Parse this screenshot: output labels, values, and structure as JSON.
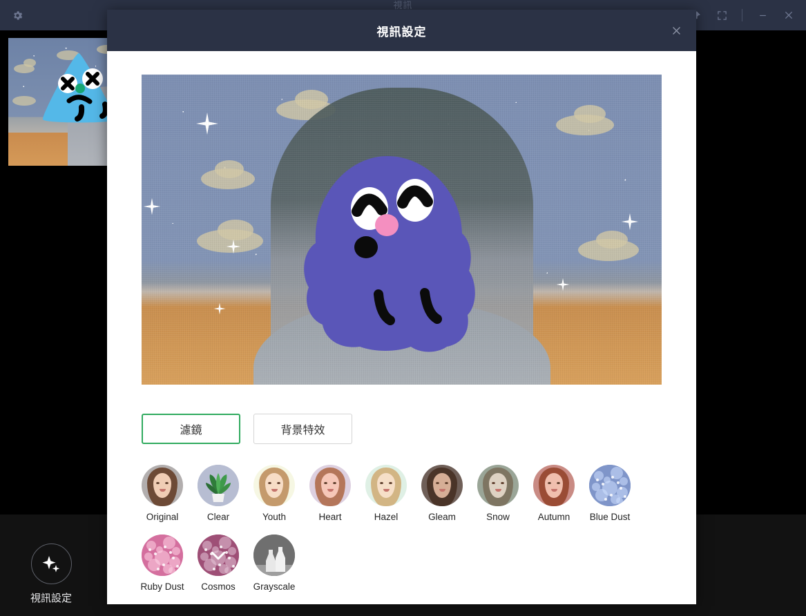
{
  "window": {
    "title_partial": "視訊",
    "gear_icon": "gear-icon",
    "controls": [
      {
        "name": "pin-icon",
        "label": "Pin"
      },
      {
        "name": "fullscreen-icon",
        "label": "Fullscreen"
      },
      {
        "name": "minimize-icon",
        "label": "Minimize"
      },
      {
        "name": "close-icon",
        "label": "Close"
      }
    ]
  },
  "toolbar": {
    "video_settings_label": "視訊設定",
    "video_settings_icon": "sparkle-icon"
  },
  "dialog": {
    "title": "視訊設定",
    "close_icon": "close-icon",
    "preview": {
      "name": "video-preview",
      "description": "Live camera preview with starry sky virtual background and purple doodle overlay"
    },
    "tabs": [
      {
        "label": "濾鏡",
        "active": true
      },
      {
        "label": "背景特效",
        "active": false
      }
    ],
    "filters": [
      {
        "label": "Original",
        "selected": false,
        "kind": "portrait",
        "bg": "#b2aeae",
        "hair": "#6d4a36",
        "skin": "#f0cdb5"
      },
      {
        "label": "Clear",
        "selected": false,
        "kind": "plant",
        "bg": "#b7bdd2"
      },
      {
        "label": "Youth",
        "selected": false,
        "kind": "portrait",
        "bg": "#f6f7e3",
        "hair": "#c49a6c",
        "skin": "#f7ddc6"
      },
      {
        "label": "Heart",
        "selected": false,
        "kind": "portrait",
        "bg": "#ddd0e0",
        "hair": "#b4765a",
        "skin": "#f6c7b8"
      },
      {
        "label": "Hazel",
        "selected": false,
        "kind": "portrait",
        "bg": "#dff0e5",
        "hair": "#d2b584",
        "skin": "#f6dfc8"
      },
      {
        "label": "Gleam",
        "selected": false,
        "kind": "portrait",
        "bg": "#6f5f58",
        "hair": "#4a3428",
        "skin": "#d6ae96"
      },
      {
        "label": "Snow",
        "selected": false,
        "kind": "portrait",
        "bg": "#9aa597",
        "hair": "#7e7562",
        "skin": "#ded2c3"
      },
      {
        "label": "Autumn",
        "selected": false,
        "kind": "portrait",
        "bg": "#c98b84",
        "hair": "#9a4c35",
        "skin": "#f0bfae"
      },
      {
        "label": "Blue Dust",
        "selected": false,
        "kind": "dust",
        "bg": "#7f95c9",
        "dust": "#cfe0ff"
      },
      {
        "label": "Ruby Dust",
        "selected": false,
        "kind": "dust",
        "bg": "#d46f9e",
        "dust": "#ffd3e6"
      },
      {
        "label": "Cosmos",
        "selected": true,
        "kind": "dust",
        "bg": "#9e4f76",
        "dust": "#e6c6d8"
      },
      {
        "label": "Grayscale",
        "selected": false,
        "kind": "bottles",
        "bg": "#6f6f6f"
      }
    ]
  },
  "colors": {
    "accent_green": "#2faa5e",
    "header_navy": "#2b3245",
    "dialog_bg": "#ffffff",
    "app_bg": "#000000",
    "strip_bg": "#121212"
  }
}
